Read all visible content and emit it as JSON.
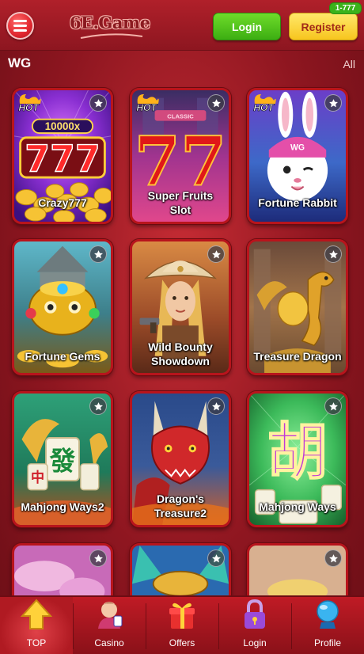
{
  "header": {
    "logo_text": "6E.Game",
    "login_label": "Login",
    "register_label": "Register",
    "register_badge": "1-777"
  },
  "section": {
    "title": "WG",
    "all_label": "All"
  },
  "games": [
    {
      "name": "Crazy777",
      "hot": true
    },
    {
      "name": "Super Fruits Slot",
      "hot": true
    },
    {
      "name": "Fortune Rabbit",
      "hot": true
    },
    {
      "name": "Fortune Gems",
      "hot": false
    },
    {
      "name": "Wild Bounty Showdown",
      "hot": false
    },
    {
      "name": "Treasure Dragon",
      "hot": false
    },
    {
      "name": "Mahjong Ways2",
      "hot": false
    },
    {
      "name": "Dragon's Treasure2",
      "hot": false
    },
    {
      "name": "Mahjong Ways",
      "hot": false
    }
  ],
  "card_art_text": {
    "crazy_multiplier": "10000x",
    "crazy_digits": "777",
    "fruits_digits": "77",
    "fruits_sign": "CLASSIC",
    "rabbit_cap": "WG",
    "mahjong_tile": "發",
    "mahjong_tile_small": "中",
    "mahjong_big_char": "胡",
    "hot_text": "HOT"
  },
  "nav": {
    "items": [
      {
        "label": "TOP",
        "icon": "top-arrow-icon"
      },
      {
        "label": "Casino",
        "icon": "casino-dealer-icon"
      },
      {
        "label": "Offers",
        "icon": "gift-box-icon"
      },
      {
        "label": "Login",
        "icon": "padlock-icon"
      },
      {
        "label": "Profile",
        "icon": "profile-globe-icon"
      }
    ]
  },
  "colors": {
    "brand_red": "#b0202a",
    "login_green": "#3cae12",
    "register_yellow": "#f7c51e"
  }
}
